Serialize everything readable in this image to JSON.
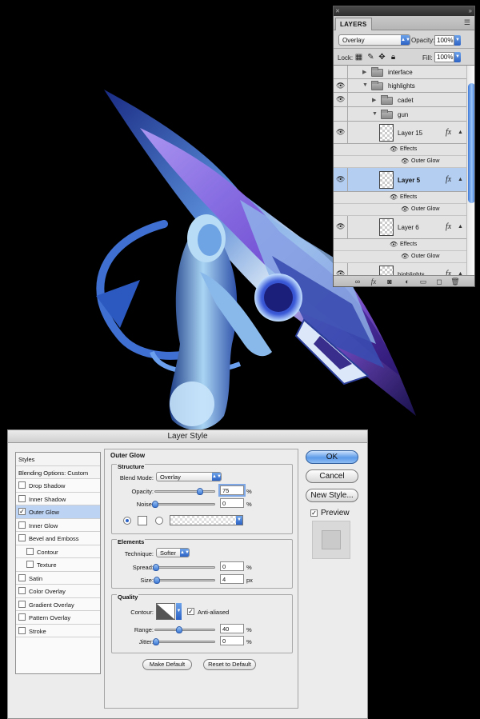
{
  "layers_panel": {
    "tab": "LAYERS",
    "blend_mode": "Overlay",
    "opacity_label": "Opacity:",
    "opacity_value": "100%",
    "lock_label": "Lock:",
    "fill_label": "Fill:",
    "fill_value": "100%",
    "rows": {
      "interface": "interface",
      "highlights": "highlights",
      "cadet": "cadet",
      "gun": "gun",
      "layer15": "Layer 15",
      "layer5": "Layer 5",
      "layer6": "Layer 6",
      "highlights_bottom": "highlights"
    },
    "effects_label": "Effects",
    "outer_glow_label": "Outer Glow",
    "fx": "fx"
  },
  "layer_style": {
    "title": "Layer Style",
    "styles_header": "Styles",
    "blending_options": "Blending Options: Custom",
    "effects": [
      {
        "label": "Drop Shadow",
        "checked": false
      },
      {
        "label": "Inner Shadow",
        "checked": false
      },
      {
        "label": "Outer Glow",
        "checked": true
      },
      {
        "label": "Inner Glow",
        "checked": false
      },
      {
        "label": "Bevel and Emboss",
        "checked": false
      },
      {
        "label": "Contour",
        "checked": false
      },
      {
        "label": "Texture",
        "checked": false
      },
      {
        "label": "Satin",
        "checked": false
      },
      {
        "label": "Color Overlay",
        "checked": false
      },
      {
        "label": "Gradient Overlay",
        "checked": false
      },
      {
        "label": "Pattern Overlay",
        "checked": false
      },
      {
        "label": "Stroke",
        "checked": false
      }
    ],
    "panel_title": "Outer Glow",
    "structure": {
      "title": "Structure",
      "blend_mode_label": "Blend Mode:",
      "blend_mode": "Overlay",
      "opacity_label": "Opacity:",
      "opacity": "75",
      "opacity_fraction": 0.75,
      "noise_label": "Noise:",
      "noise": "0",
      "noise_fraction": 0,
      "percent": "%"
    },
    "elements": {
      "title": "Elements",
      "technique_label": "Technique:",
      "technique": "Softer",
      "spread_label": "Spread:",
      "spread": "0",
      "spread_unit": "%",
      "size_label": "Size:",
      "size": "4",
      "size_unit": "px"
    },
    "quality": {
      "title": "Quality",
      "contour_label": "Contour:",
      "anti_aliased_label": "Anti-aliased",
      "anti_aliased": true,
      "range_label": "Range:",
      "range": "40",
      "range_fraction": 0.4,
      "jitter_label": "Jitter:",
      "jitter": "0",
      "percent": "%"
    },
    "make_default": "Make Default",
    "reset_default": "Reset to Default",
    "buttons": {
      "ok": "OK",
      "cancel": "Cancel",
      "new_style": "New Style..."
    },
    "preview_label": "Preview",
    "preview_checked": true
  },
  "colors": {
    "selection_blue": "#b4cef1",
    "aqua_blue": "#3c78d6",
    "artwork_bg": "#000000"
  }
}
